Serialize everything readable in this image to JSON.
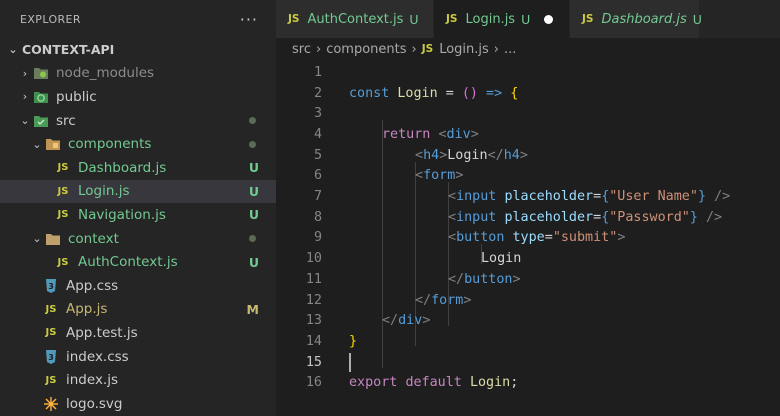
{
  "sidebar": {
    "title": "EXPLORER",
    "more": "···",
    "root": "CONTEXT-API",
    "items": [
      {
        "label": "node_modules",
        "badge": ""
      },
      {
        "label": "public",
        "badge": ""
      },
      {
        "label": "src",
        "badge": ""
      },
      {
        "label": "components",
        "badge": ""
      },
      {
        "label": "Dashboard.js",
        "badge": "U"
      },
      {
        "label": "Login.js",
        "badge": "U"
      },
      {
        "label": "Navigation.js",
        "badge": "U"
      },
      {
        "label": "context",
        "badge": ""
      },
      {
        "label": "AuthContext.js",
        "badge": "U"
      },
      {
        "label": "App.css",
        "badge": ""
      },
      {
        "label": "App.js",
        "badge": "M"
      },
      {
        "label": "App.test.js",
        "badge": ""
      },
      {
        "label": "index.css",
        "badge": ""
      },
      {
        "label": "index.js",
        "badge": ""
      },
      {
        "label": "logo.svg",
        "badge": ""
      }
    ],
    "icons": {
      "js": "JS",
      "css": "3"
    }
  },
  "tabs": [
    {
      "label": "AuthContext.js",
      "badge": "U"
    },
    {
      "label": "Login.js",
      "badge": "U"
    },
    {
      "label": "Dashboard.js",
      "badge": "U"
    }
  ],
  "breadcrumb": {
    "src": "src",
    "components": "components",
    "file": "Login.js",
    "more": "..."
  },
  "editor": {
    "line_numbers": [
      "1",
      "2",
      "3",
      "4",
      "5",
      "6",
      "7",
      "8",
      "9",
      "10",
      "11",
      "12",
      "13",
      "14",
      "15",
      "16"
    ],
    "current_line": "15",
    "code": {
      "l2": {
        "const": "const",
        "name": "Login",
        "eq": " = ",
        "paren": "()",
        "arrow": " => ",
        "brace": "{"
      },
      "l4": {
        "return": "return",
        "tag": "div"
      },
      "l5": {
        "tag": "h4",
        "text": "Login"
      },
      "l6": {
        "tag": "form"
      },
      "l7": {
        "tag": "input",
        "attr": "placeholder",
        "value": "\"User Name\""
      },
      "l8": {
        "tag": "input",
        "attr": "placeholder",
        "value": "\"Password\""
      },
      "l9": {
        "tag": "button",
        "attr": "type",
        "value": "\"submit\""
      },
      "l10": {
        "text": "Login"
      },
      "l11": {
        "tag": "button"
      },
      "l12": {
        "tag": "form"
      },
      "l13": {
        "tag": "div"
      },
      "l14": {
        "brace": "}"
      },
      "l16": {
        "export": "export",
        "default": "default",
        "name": "Login",
        "semi": ";"
      }
    }
  },
  "colors": {
    "accent": "#73c991",
    "modified": "#c7b771",
    "js_icon": "#cbcb41",
    "css_icon": "#519aba"
  }
}
